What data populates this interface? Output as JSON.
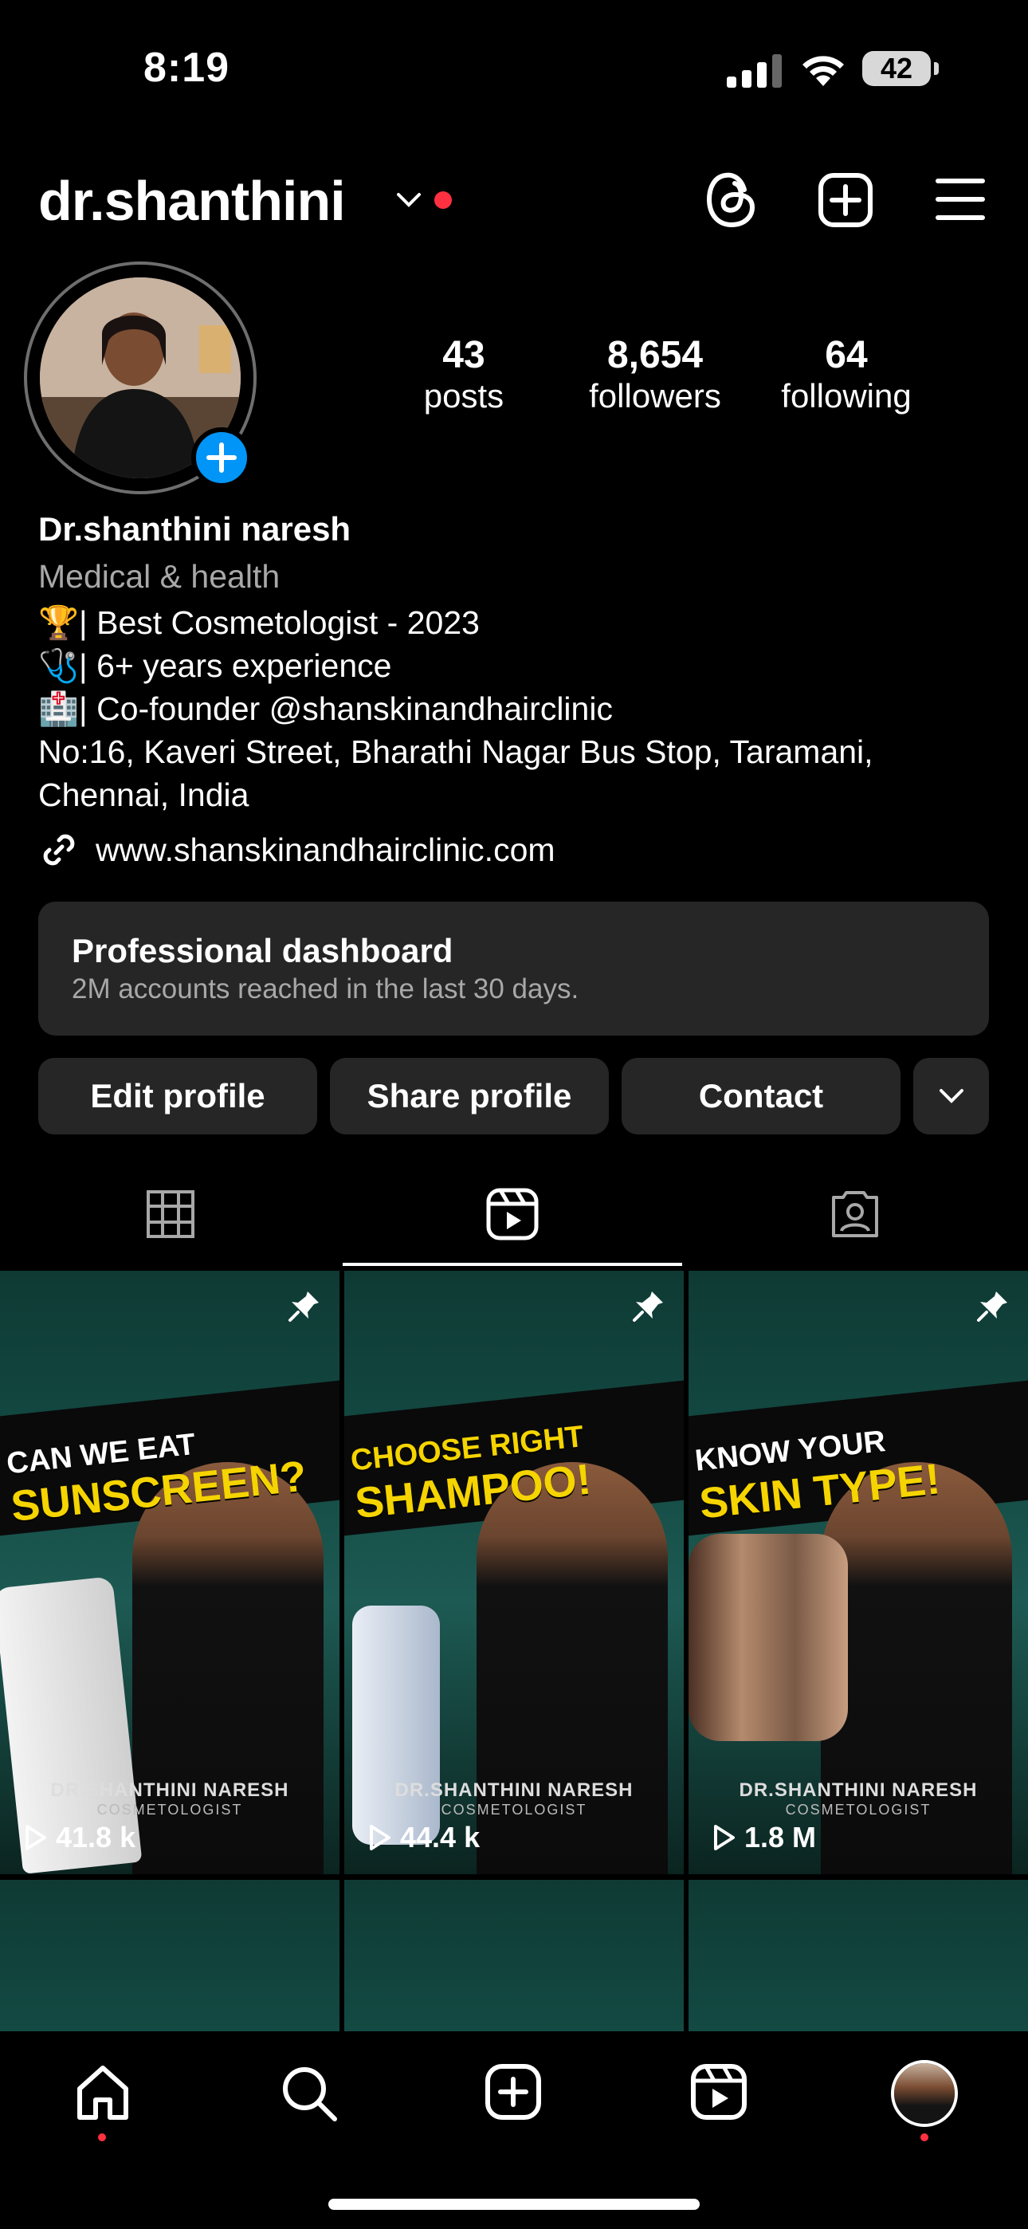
{
  "status_bar": {
    "time": "8:19",
    "battery": "42"
  },
  "header": {
    "username": "dr.shanthini"
  },
  "stats": [
    {
      "value": "43",
      "label": "posts"
    },
    {
      "value": "8,654",
      "label": "followers"
    },
    {
      "value": "64",
      "label": "following"
    }
  ],
  "bio": {
    "name": "Dr.shanthini naresh",
    "category": "Medical & health",
    "lines": [
      "🏆| Best Cosmetologist - 2023",
      "🩺| 6+ years experience",
      "🏥| Co-founder @shanskinandhairclinic",
      "No:16, Kaveri Street, Bharathi Nagar Bus Stop, Taramani,",
      "Chennai, India"
    ],
    "link": "www.shanskinandhairclinic.com"
  },
  "dashboard": {
    "title": "Professional dashboard",
    "subtitle": "2M accounts reached in the last 30 days."
  },
  "buttons": {
    "edit": "Edit profile",
    "share": "Share profile",
    "contact": "Contact"
  },
  "reels": [
    {
      "headline_top": "CAN WE EAT",
      "headline_main": "SUNSCREEN?",
      "credit": "DR.SHANTHINI NARESH",
      "credit_sub": "COSMETOLOGIST",
      "views": "41.8 k"
    },
    {
      "headline_top": "CHOOSE RIGHT",
      "headline_main": "SHAMPOO!",
      "credit": "DR.SHANTHINI NARESH",
      "credit_sub": "COSMETOLOGIST",
      "views": "44.4 k"
    },
    {
      "headline_top": "KNOW YOUR",
      "headline_main": "SKIN TYPE!",
      "credit": "DR.SHANTHINI NARESH",
      "credit_sub": "COSMETOLOGIST",
      "views": "1.8 M"
    }
  ],
  "colors": {
    "accent_blue": "#0095f6",
    "notification_red": "#ff3040",
    "surface": "#262626",
    "secondary_text": "#a8a8a8"
  },
  "icons": [
    "threads-icon",
    "create-icon",
    "menu-icon",
    "grid-icon",
    "reels-icon",
    "tagged-icon",
    "home-icon",
    "search-icon",
    "add-icon",
    "reels-nav-icon",
    "profile-avatar"
  ]
}
